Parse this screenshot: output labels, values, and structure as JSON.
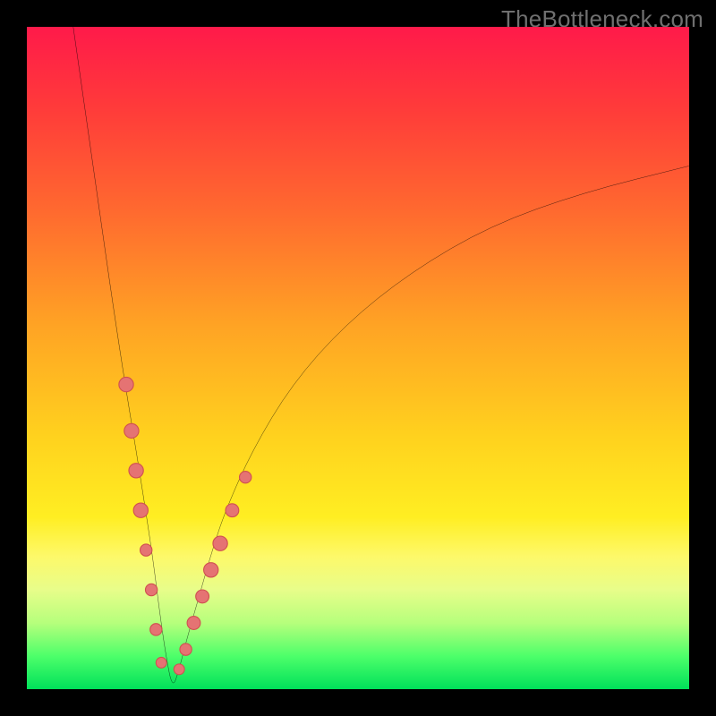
{
  "watermark": "TheBottleneck.com",
  "colors": {
    "frame": "#000000",
    "curve": "#000000",
    "marker_fill": "#e57373",
    "marker_stroke": "#d05050",
    "gradient_stops": [
      {
        "pct": 0,
        "hex": "#ff1a4a"
      },
      {
        "pct": 12,
        "hex": "#ff3a3a"
      },
      {
        "pct": 28,
        "hex": "#ff6a2f"
      },
      {
        "pct": 45,
        "hex": "#ffa324"
      },
      {
        "pct": 62,
        "hex": "#ffd21e"
      },
      {
        "pct": 74,
        "hex": "#ffee22"
      },
      {
        "pct": 80,
        "hex": "#fdf96a"
      },
      {
        "pct": 85,
        "hex": "#e8fd8a"
      },
      {
        "pct": 90,
        "hex": "#b6ff7c"
      },
      {
        "pct": 95,
        "hex": "#4dff6a"
      },
      {
        "pct": 100,
        "hex": "#00e05a"
      }
    ]
  },
  "chart_data": {
    "type": "line",
    "title": "",
    "xlabel": "",
    "ylabel": "",
    "xlim": [
      0,
      100
    ],
    "ylim": [
      0,
      100
    ],
    "notes": "Bottleneck-style V curve; minimum (0% bottleneck) near x≈22. Left branch rises to 100% at x≈7; right branch rises asymptotically toward ~80% at x=100. Pink markers cluster on both branches near the valley in the 55–77% band.",
    "series": [
      {
        "name": "curve",
        "x": [
          7,
          9,
          11,
          13,
          15,
          17,
          19,
          20,
          21,
          22,
          23,
          24,
          26,
          28,
          30,
          34,
          40,
          48,
          58,
          70,
          84,
          100
        ],
        "y": [
          100,
          86,
          72,
          58,
          45,
          33,
          20,
          12,
          5,
          0,
          3,
          7,
          14,
          21,
          27,
          36,
          46,
          55,
          63,
          70,
          75,
          79
        ]
      }
    ],
    "markers": [
      {
        "x": 15.0,
        "y": 46.0,
        "r": 1.1
      },
      {
        "x": 15.8,
        "y": 39.0,
        "r": 1.1
      },
      {
        "x": 16.5,
        "y": 33.0,
        "r": 1.1
      },
      {
        "x": 17.2,
        "y": 27.0,
        "r": 1.1
      },
      {
        "x": 18.0,
        "y": 21.0,
        "r": 0.9
      },
      {
        "x": 18.8,
        "y": 15.0,
        "r": 0.9
      },
      {
        "x": 19.5,
        "y": 9.0,
        "r": 0.9
      },
      {
        "x": 20.3,
        "y": 4.0,
        "r": 0.8
      },
      {
        "x": 23.0,
        "y": 3.0,
        "r": 0.8
      },
      {
        "x": 24.0,
        "y": 6.0,
        "r": 0.9
      },
      {
        "x": 25.2,
        "y": 10.0,
        "r": 1.0
      },
      {
        "x": 26.5,
        "y": 14.0,
        "r": 1.0
      },
      {
        "x": 27.8,
        "y": 18.0,
        "r": 1.1
      },
      {
        "x": 29.2,
        "y": 22.0,
        "r": 1.1
      },
      {
        "x": 31.0,
        "y": 27.0,
        "r": 1.0
      },
      {
        "x": 33.0,
        "y": 32.0,
        "r": 0.9
      }
    ]
  }
}
